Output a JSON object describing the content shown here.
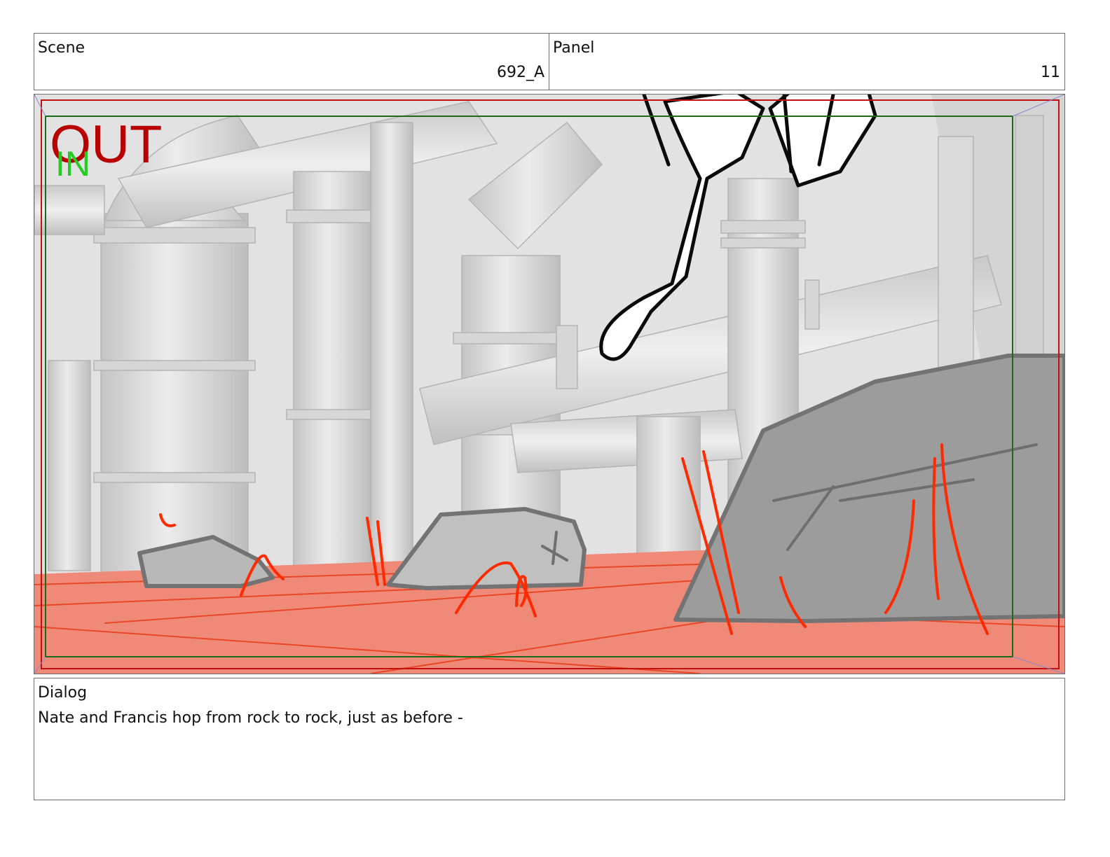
{
  "header": {
    "scene": {
      "label": "Scene",
      "value": "692_A"
    },
    "panel": {
      "label": "Panel",
      "value": "11"
    }
  },
  "frame": {
    "out_label": "OUT",
    "in_label": "IN",
    "colors": {
      "out": "#b80000",
      "in": "#22cc22",
      "floor": "#ef8a78",
      "sketch_red": "#ff2a00",
      "rock": "#9c9c9c",
      "pipes": "#d8d8d8"
    }
  },
  "dialog": {
    "label": "Dialog",
    "text": "Nate and Francis hop from rock to rock, just as before -"
  }
}
